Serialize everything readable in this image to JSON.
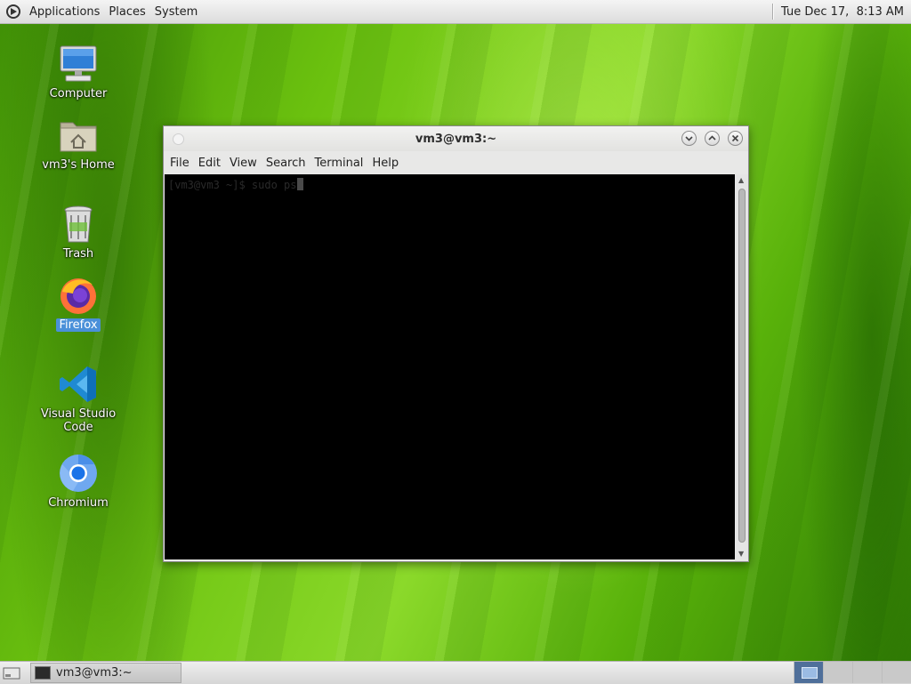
{
  "top_panel": {
    "menus": [
      "Applications",
      "Places",
      "System"
    ],
    "clock": "Tue Dec 17,  8:13 AM"
  },
  "desktop_icons": [
    {
      "label": "Computer",
      "icon": "computer-icon"
    },
    {
      "label": "vm3's Home",
      "icon": "home-folder-icon"
    },
    {
      "label": "Trash",
      "icon": "trash-icon"
    },
    {
      "label": "Firefox",
      "icon": "firefox-icon",
      "selected": true
    },
    {
      "label": "Visual Studio Code",
      "icon": "vscode-icon"
    },
    {
      "label": "Chromium",
      "icon": "chromium-icon"
    }
  ],
  "terminal": {
    "title": "vm3@vm3:~",
    "menus": [
      "File",
      "Edit",
      "View",
      "Search",
      "Terminal",
      "Help"
    ],
    "prompt": "[vm3@vm3 ~]$ sudo ps"
  },
  "taskbar": {
    "task_label": "vm3@vm3:~",
    "workspace_count": 4,
    "active_workspace": 1
  }
}
